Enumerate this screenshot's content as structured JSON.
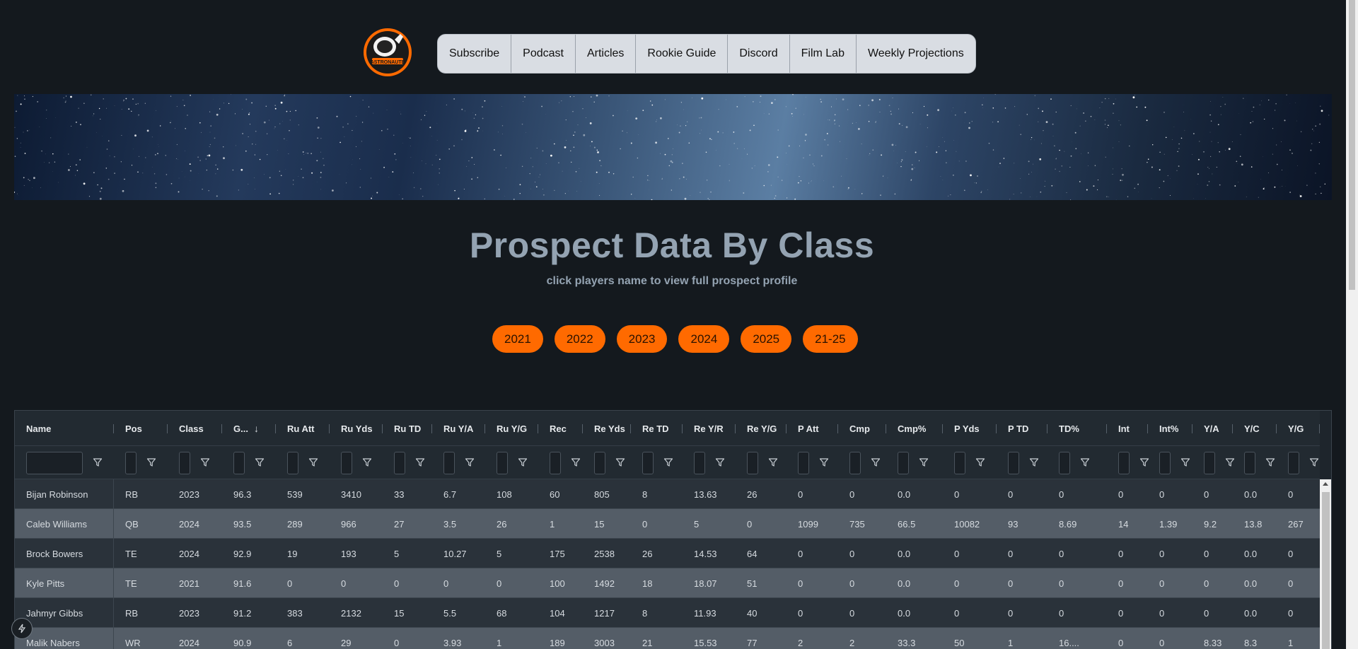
{
  "nav": {
    "items": [
      "Subscribe",
      "Podcast",
      "Articles",
      "Rookie Guide",
      "Discord",
      "Film Lab",
      "Weekly Projections"
    ]
  },
  "logo": {
    "icon": "astronaut-logo",
    "text": "ASTRONAUTE"
  },
  "hero": {
    "title": "Prospect Data By Class",
    "subtitle": "click players name to view full prospect profile"
  },
  "years": [
    "2021",
    "2022",
    "2023",
    "2024",
    "2025",
    "21-25"
  ],
  "colors": {
    "accent": "#ff6a00",
    "background": "#14191e",
    "row_even": "#2a323a",
    "row_odd": "#545d67"
  },
  "table": {
    "columns": [
      "Name",
      "Pos",
      "Class",
      "G...",
      "Ru Att",
      "Ru Yds",
      "Ru TD",
      "Ru Y/A",
      "Ru Y/G",
      "Rec",
      "Re Yds",
      "Re TD",
      "Re Y/R",
      "Re Y/G",
      "P Att",
      "Cmp",
      "Cmp%",
      "P Yds",
      "P TD",
      "TD%",
      "Int",
      "Int%",
      "Y/A",
      "Y/C",
      "Y/G"
    ],
    "sort_icon": "arrow-down-icon",
    "filter_icon": "filter-icon",
    "rows": [
      [
        "Bijan Robinson",
        "RB",
        "2023",
        "96.3",
        "539",
        "3410",
        "33",
        "6.7",
        "108",
        "60",
        "805",
        "8",
        "13.63",
        "26",
        "0",
        "0",
        "0.0",
        "0",
        "0",
        "0",
        "0",
        "0",
        "0",
        "0.0",
        "0"
      ],
      [
        "Caleb Williams",
        "QB",
        "2024",
        "93.5",
        "289",
        "966",
        "27",
        "3.5",
        "26",
        "1",
        "15",
        "0",
        "5",
        "0",
        "1099",
        "735",
        "66.5",
        "10082",
        "93",
        "8.69",
        "14",
        "1.39",
        "9.2",
        "13.8",
        "267"
      ],
      [
        "Brock Bowers",
        "TE",
        "2024",
        "92.9",
        "19",
        "193",
        "5",
        "10.27",
        "5",
        "175",
        "2538",
        "26",
        "14.53",
        "64",
        "0",
        "0",
        "0.0",
        "0",
        "0",
        "0",
        "0",
        "0",
        "0",
        "0.0",
        "0"
      ],
      [
        "Kyle Pitts",
        "TE",
        "2021",
        "91.6",
        "0",
        "0",
        "0",
        "0",
        "0",
        "100",
        "1492",
        "18",
        "18.07",
        "51",
        "0",
        "0",
        "0.0",
        "0",
        "0",
        "0",
        "0",
        "0",
        "0",
        "0.0",
        "0"
      ],
      [
        "Jahmyr Gibbs",
        "RB",
        "2023",
        "91.2",
        "383",
        "2132",
        "15",
        "5.5",
        "68",
        "104",
        "1217",
        "8",
        "11.93",
        "40",
        "0",
        "0",
        "0.0",
        "0",
        "0",
        "0",
        "0",
        "0",
        "0",
        "0.0",
        "0"
      ],
      [
        "Malik Nabers",
        "WR",
        "2024",
        "90.9",
        "6",
        "29",
        "0",
        "3.93",
        "1",
        "189",
        "3003",
        "21",
        "15.53",
        "77",
        "2",
        "2",
        "33.3",
        "50",
        "1",
        "16....",
        "0",
        "0",
        "8.33",
        "8.3",
        "1"
      ]
    ]
  }
}
